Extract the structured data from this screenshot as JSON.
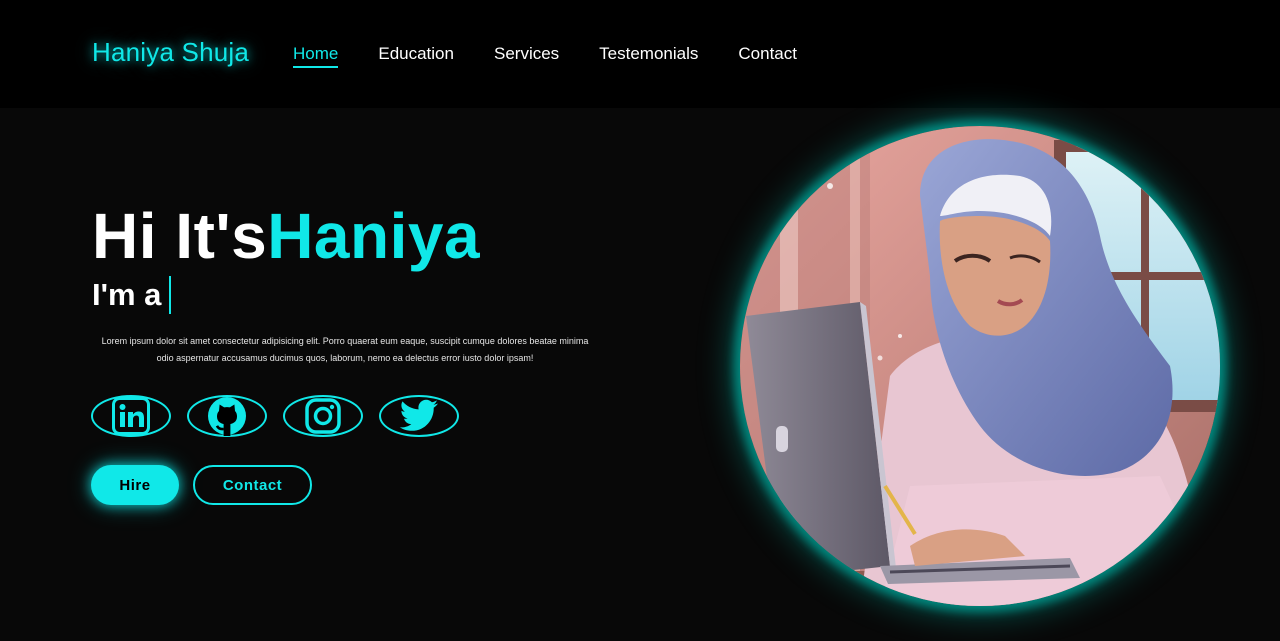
{
  "header": {
    "logo": "Haniya Shuja",
    "nav": [
      {
        "label": "Home",
        "active": true
      },
      {
        "label": "Education",
        "active": false
      },
      {
        "label": "Services",
        "active": false
      },
      {
        "label": "Testemonials",
        "active": false
      },
      {
        "label": "Contact",
        "active": false
      }
    ]
  },
  "hero": {
    "greeting": "Hi It's",
    "name": "Haniya",
    "role_prefix": "I'm a",
    "description": "Lorem ipsum dolor sit amet consectetur adipisicing elit. Porro quaerat eum eaque, suscipit cumque dolores beatae minima odio aspernatur accusamus ducimus quos, laborum, nemo ea delectus error iusto dolor ipsam!",
    "socials": [
      "linkedin-icon",
      "github-icon",
      "instagram-icon",
      "twitter-icon"
    ],
    "buttons": {
      "hire": "Hire",
      "contact": "Contact"
    }
  },
  "colors": {
    "accent": "#10e8e8",
    "background": "#080808",
    "header_background": "#000000",
    "text": "#ffffff"
  }
}
